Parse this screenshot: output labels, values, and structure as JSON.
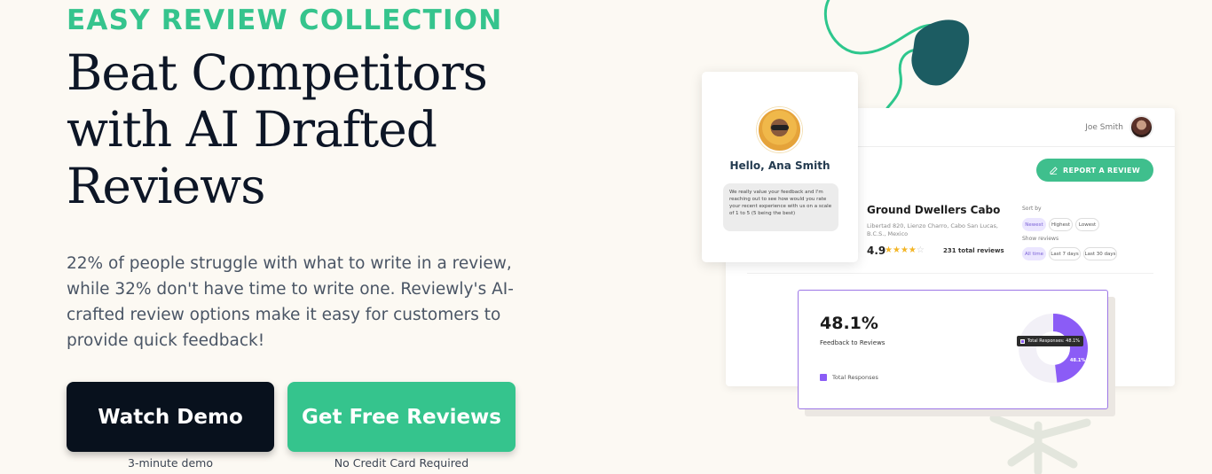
{
  "hero": {
    "eyebrow": "EASY REVIEW COLLECTION",
    "headline": [
      "Beat Competitors",
      "with AI Drafted",
      "Reviews"
    ],
    "body": "22% of people struggle with what to write in a review, while 32% don't have time to write one. Reviewly's AI-crafted review options make it easy for customers to provide quick feedback!",
    "buttons": {
      "demo_label": "Watch Demo",
      "demo_caption": "3-minute demo",
      "free_label": "Get Free Reviews",
      "free_caption": "No Credit Card Required"
    }
  },
  "dashboard": {
    "user_name": "Joe Smith",
    "report_button": "REPORT A REVIEW",
    "business": {
      "name": "Ground Dwellers Cabo",
      "address": "Libertad 820, Lienzo Charro, Cabo San Lucas, B.C.S., Mexico",
      "rating": "4.9",
      "stars_filled": 4,
      "stars_total": 5,
      "total_reviews": "231 total reviews"
    },
    "sort": {
      "label": "Sort by",
      "options": [
        "Newest",
        "Highest",
        "Lowest"
      ],
      "selected": "Newest"
    },
    "show": {
      "label": "Show reviews",
      "options": [
        "All time",
        "Last 7 days",
        "Last 30 days"
      ],
      "selected": "All time"
    }
  },
  "stats": {
    "percent": "48.1%",
    "label": "Feedback to Reviews",
    "legend": "Total Responses",
    "tooltip": "Total Responses: 48.1%",
    "donut_label": "48.1%",
    "donut_value": 0.481
  },
  "message": {
    "greeting": "Hello, Ana Smith",
    "text": "We really value your feedback and I'm reaching out to see how would you rate your recent experience with us on a scale of 1 to 5 (5 being the best)"
  },
  "colors": {
    "accent_green": "#35c48d",
    "dark_button": "#08111d",
    "purple": "#8b5cf6",
    "deco_teal": "#1c5c62",
    "background": "#fcf9f3"
  },
  "icons": [
    "pencil-icon",
    "star-icon",
    "decorative-squiggle",
    "decorative-blob"
  ]
}
